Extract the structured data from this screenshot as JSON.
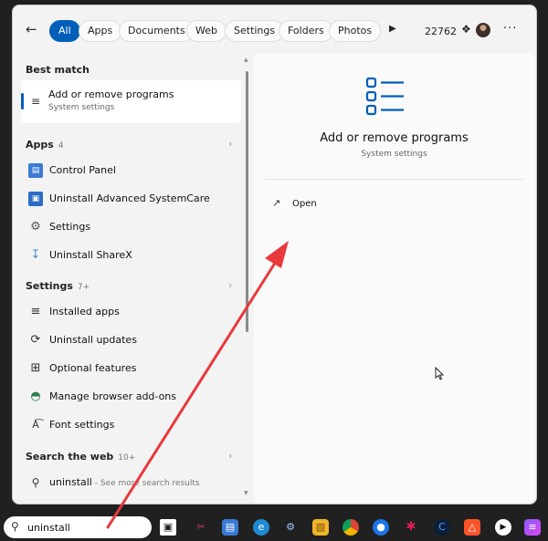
{
  "topbar": {
    "back_icon": "back-arrow-icon",
    "filters": [
      "All",
      "Apps",
      "Documents",
      "Web",
      "Settings",
      "Folders",
      "Photos"
    ],
    "active_filter": "All",
    "points": "22762",
    "points_icon": "rewards-medal-icon"
  },
  "best_match": {
    "heading": "Best match",
    "title": "Add or remove programs",
    "subtitle": "System settings"
  },
  "apps": {
    "heading": "Apps",
    "count": "4",
    "items": [
      "Control Panel",
      "Uninstall Advanced SystemCare",
      "Settings",
      "Uninstall ShareX"
    ]
  },
  "settings": {
    "heading": "Settings",
    "count": "7+",
    "items": [
      "Installed apps",
      "Uninstall updates",
      "Optional features",
      "Manage browser add-ons",
      "Font settings"
    ]
  },
  "web": {
    "heading": "Search the web",
    "count": "10+",
    "query": "uninstall",
    "more": " - See more search results"
  },
  "preview": {
    "title": "Add or remove programs",
    "subtitle": "System settings",
    "open_label": "Open"
  },
  "taskbar": {
    "search_value": "uninstall",
    "apps": [
      "task-view",
      "snipping-tool",
      "control-panel",
      "edge",
      "settings-app",
      "file-explorer",
      "chrome",
      "firefox",
      "slack",
      "ccleaner",
      "brave",
      "media-player",
      "terminal"
    ]
  },
  "colors": {
    "accent": "#005fb8",
    "annotation_arrow": "#e8393b"
  }
}
